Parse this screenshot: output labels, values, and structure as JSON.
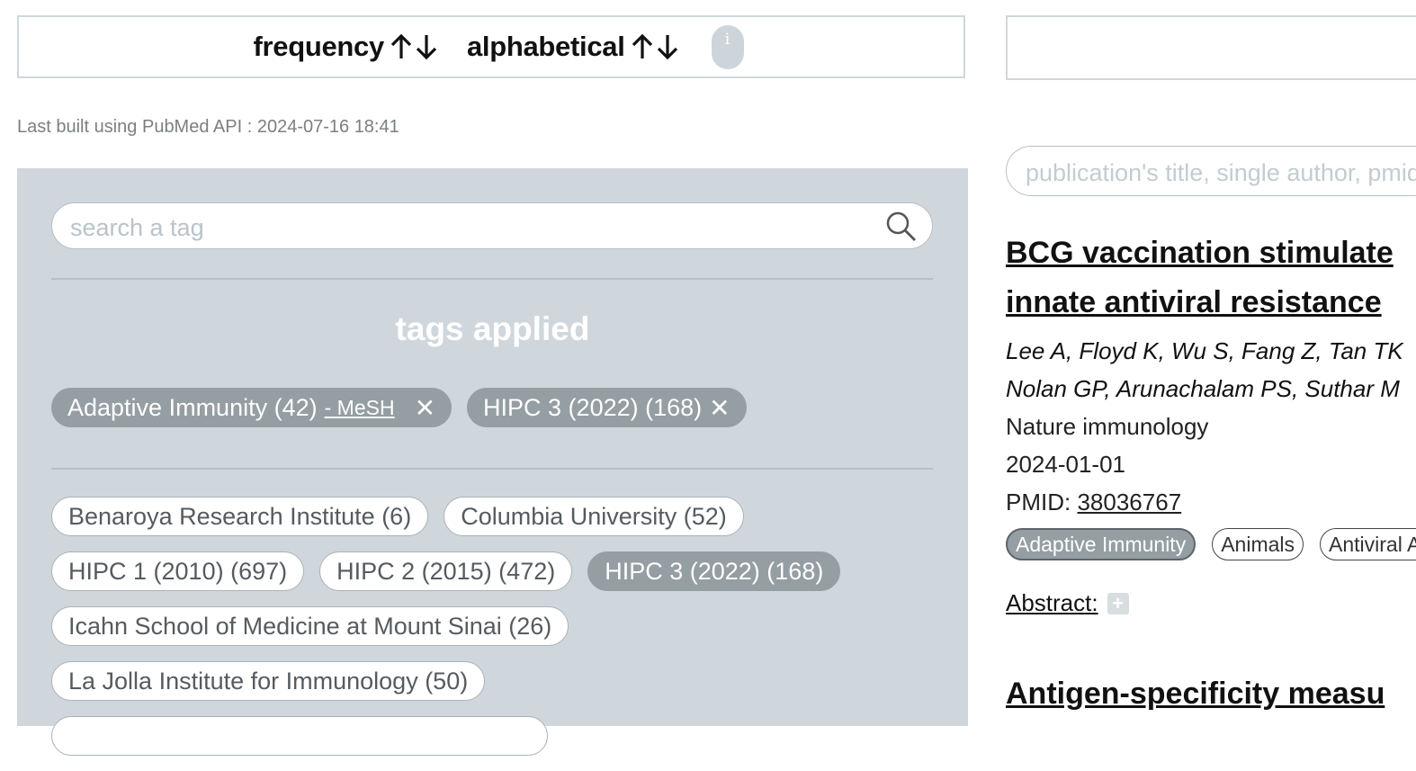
{
  "sort": {
    "frequency_label": "frequency",
    "alphabetical_label": "alphabetical",
    "info_label": "i"
  },
  "last_built": "Last built using PubMed API : 2024-07-16 18:41",
  "tag_search": {
    "placeholder": "search a tag"
  },
  "applied": {
    "title": "tags applied",
    "tags": [
      {
        "label": "Adaptive Immunity (42)",
        "mesh": "- MeSH"
      },
      {
        "label": "HIPC 3 (2022) (168)"
      }
    ],
    "remove_symbol": "✕"
  },
  "tag_rows": [
    [
      "Benaroya Research Institute (6)",
      "Columbia University (52)"
    ],
    [
      "HIPC 1 (2010) (697)",
      "HIPC 2 (2015) (472)",
      "HIPC 3 (2022) (168)"
    ],
    [
      "Icahn School of Medicine at Mount Sinai (26)"
    ],
    [
      "La Jolla Institute for Immunology (50)"
    ]
  ],
  "pub_search": {
    "placeholder": "publication's title, single author, pmid"
  },
  "publications": [
    {
      "title_line1": "BCG vaccination stimulate",
      "title_line2": "innate antiviral resistance",
      "authors_line1": "Lee A, Floyd K, Wu S, Fang Z, Tan TK",
      "authors_line2": "Nolan GP, Arunachalam PS, Suthar M",
      "journal": "Nature immunology",
      "date": "2024-01-01",
      "pmid_label": "PMID:",
      "pmid": "38036767",
      "tags": [
        "Adaptive Immunity",
        "Animals",
        "Antiviral Ag"
      ],
      "abstract_label": "Abstract:",
      "expand_symbol": "+"
    },
    {
      "title_line1": "Antigen-specificity measu"
    }
  ],
  "colors": {
    "panel_bg": "#cfd7dc",
    "pill_active": "#949ea3",
    "border": "#cfd7dc"
  }
}
